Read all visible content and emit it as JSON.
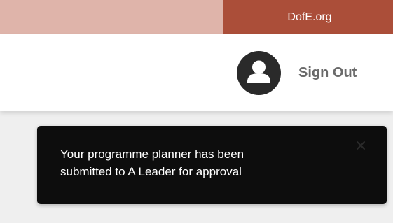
{
  "top_bar": {
    "link_label": "DofE.org",
    "strip_color": "#dfb4aa",
    "link_color": "#ab4e39"
  },
  "header": {
    "avatar_icon": "user-icon",
    "sign_out_label": "Sign Out"
  },
  "toast": {
    "message_line1": "Your programme planner has been",
    "message_line2": "submitted to A Leader for approval",
    "close_icon": "close-icon"
  }
}
